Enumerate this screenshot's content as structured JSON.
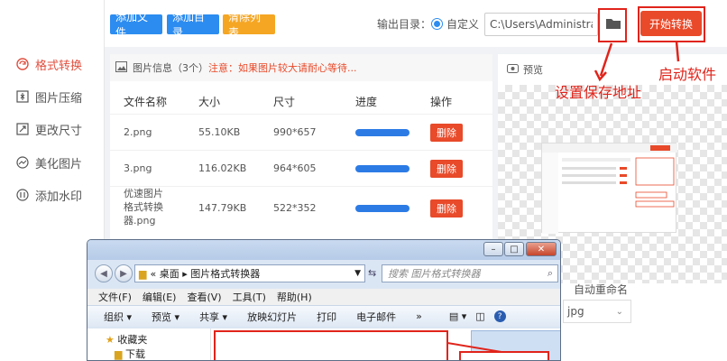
{
  "sidebar": {
    "items": [
      {
        "label": "格式转换",
        "icon": "refresh-icon",
        "active": true
      },
      {
        "label": "图片压缩",
        "icon": "compress-icon"
      },
      {
        "label": "更改尺寸",
        "icon": "resize-icon"
      },
      {
        "label": "美化图片",
        "icon": "beautify-icon"
      },
      {
        "label": "添加水印",
        "icon": "watermark-icon"
      }
    ]
  },
  "toolbar": {
    "add_file": "添加文件",
    "add_dir": "添加目录",
    "clear_list": "清除列表",
    "output_label": "输出目录：",
    "radio_custom": "自定义",
    "output_path": "C:\\Users\\Administrator\\",
    "start": "开始转换",
    "colors": {
      "blue": "#2c8cf0",
      "orange": "#f5a623",
      "red": "#e84a2a"
    }
  },
  "panel": {
    "title": "图片信息（3个）",
    "warning": "注意：如果图片较大请耐心等待...",
    "headers": {
      "name": "文件名称",
      "size": "大小",
      "dims": "尺寸",
      "progress": "进度",
      "action": "操作"
    },
    "rows": [
      {
        "name": "2.png",
        "size": "55.10KB",
        "dims": "990*657",
        "progress": 1.0,
        "action": "删除"
      },
      {
        "name": "3.png",
        "size": "116.02KB",
        "dims": "964*605",
        "progress": 1.0,
        "action": "删除"
      },
      {
        "name": "优速图片格式转换器.png",
        "name_lines": [
          "优速图片",
          "格式转换",
          "器.png"
        ],
        "size": "147.79KB",
        "dims": "522*352",
        "progress": 1.0,
        "action": "删除"
      }
    ]
  },
  "preview": {
    "title": "预览",
    "rename_label": "自动重命名",
    "format_value": "jpg"
  },
  "annotations": {
    "set_path": "设置保存地址",
    "start_soft": "启动软件"
  },
  "explorer": {
    "breadcrumb": "« 桌面 ▸ 图片格式转换器",
    "search_placeholder": "搜索 图片格式转换器",
    "menu": [
      "文件(F)",
      "编辑(E)",
      "查看(V)",
      "工具(T)",
      "帮助(H)"
    ],
    "commands": [
      "组织 ▾",
      "预览 ▾",
      "共享 ▾",
      "放映幻灯片",
      "打印",
      "电子邮件",
      "»"
    ],
    "nav_items": [
      "收藏夹",
      "下载"
    ]
  }
}
